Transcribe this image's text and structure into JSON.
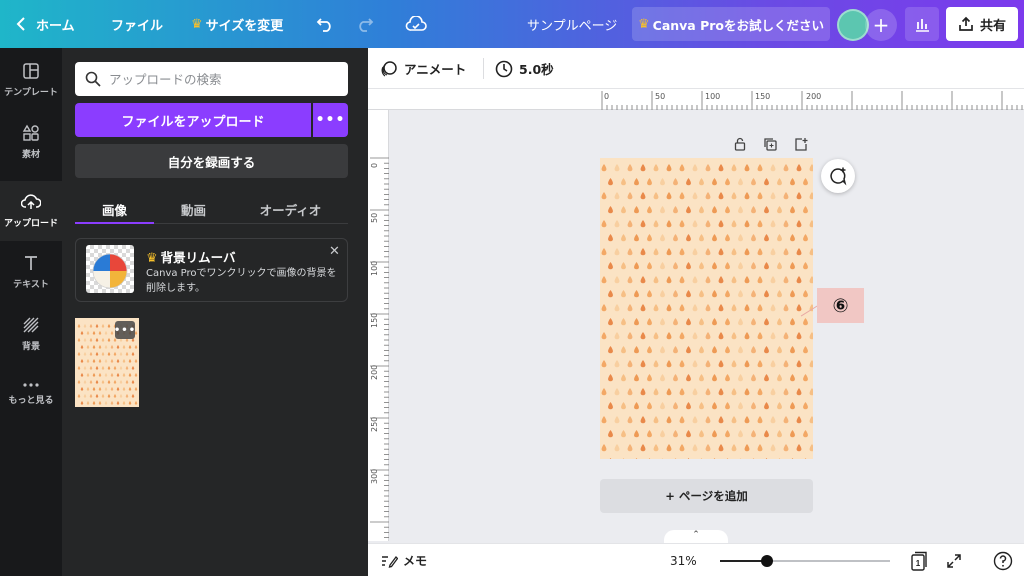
{
  "topbar": {
    "home_label": "ホーム",
    "file_label": "ファイル",
    "resize_label": "サイズを変更",
    "doc_title": "サンプルページ",
    "try_pro_label": "Canva Proをお試しください",
    "share_label": "共有"
  },
  "rail": {
    "items": [
      {
        "label": "テンプレート",
        "icon": "templates-icon"
      },
      {
        "label": "素材",
        "icon": "elements-icon"
      },
      {
        "label": "アップロード",
        "icon": "upload-cloud-icon"
      },
      {
        "label": "テキスト",
        "icon": "text-icon"
      },
      {
        "label": "背景",
        "icon": "background-icon"
      },
      {
        "label": "もっと見る",
        "icon": "more-icon"
      }
    ],
    "active_index": 2
  },
  "panel": {
    "search_placeholder": "アップロードの検索",
    "upload_button": "ファイルをアップロード",
    "record_button": "自分を録画する",
    "tabs": [
      {
        "label": "画像"
      },
      {
        "label": "動画"
      },
      {
        "label": "オーディオ"
      }
    ],
    "active_tab": 0,
    "promo": {
      "title": "背景リムーバ",
      "description": "Canva Proでワンクリックで画像の背景を削除します。"
    }
  },
  "editor": {
    "animate_label": "アニメート",
    "duration_label": "5.0秒",
    "ruler_top": [
      "0",
      "50",
      "100",
      "150",
      "200"
    ],
    "ruler_left": [
      "0",
      "50",
      "100",
      "150",
      "200",
      "250",
      "300"
    ],
    "add_page_label": "+ ページを追加",
    "annotation_marker": "⑥"
  },
  "bottom": {
    "notes_label": "メモ",
    "zoom_label": "31%",
    "zoom_fraction": 0.31,
    "page_count": "1"
  },
  "colors": {
    "accent": "#8b3dff",
    "panel_bg": "#252627",
    "rail_bg": "#18191b",
    "page_bg": "#fbe3c4"
  }
}
